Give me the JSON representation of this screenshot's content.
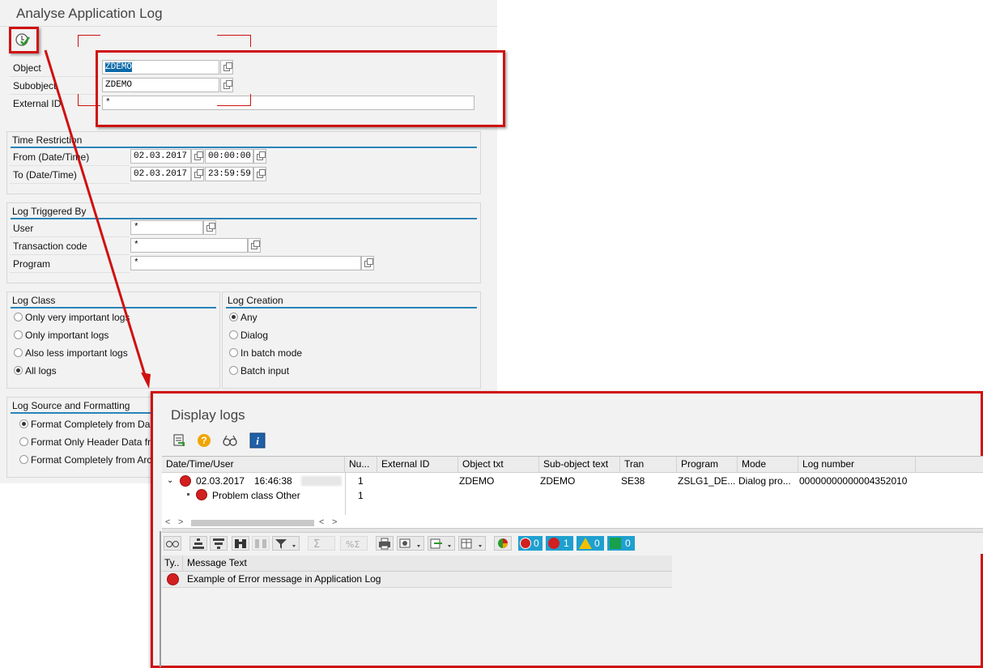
{
  "selection": {
    "title": "Analyse Application Log",
    "object_label": "Object",
    "object_value": "ZDEMO",
    "subobject_label": "Subobject",
    "subobject_value": "ZDEMO",
    "external_id_label": "External ID",
    "external_id_value": "*",
    "time_restriction": {
      "title": "Time Restriction",
      "from_label": "From (Date/Time)",
      "from_date": "02.03.2017",
      "from_time": "00:00:00",
      "to_label": "To (Date/Time)",
      "to_date": "02.03.2017",
      "to_time": "23:59:59"
    },
    "triggered_by": {
      "title": "Log Triggered By",
      "user_label": "User",
      "user_value": "*",
      "tcode_label": "Transaction code",
      "tcode_value": "*",
      "program_label": "Program",
      "program_value": "*"
    },
    "log_class": {
      "title": "Log Class",
      "options": [
        "Only very important logs",
        "Only important logs",
        "Also less important logs",
        "All logs"
      ],
      "selected": "All logs"
    },
    "log_creation": {
      "title": "Log Creation",
      "options": [
        "Any",
        "Dialog",
        "In batch mode",
        "Batch input"
      ],
      "selected": "Any"
    },
    "log_source": {
      "title": "Log Source and Formatting",
      "options": [
        "Format Completely from Da",
        "Format Only Header Data fr",
        "Format Completely from Arc"
      ],
      "selected": "Format Completely from Da"
    }
  },
  "display": {
    "title": "Display logs",
    "columns": [
      "Date/Time/User",
      "Nu...",
      "External ID",
      "Object txt",
      "Sub-object text",
      "Tran",
      "Program",
      "Mode",
      "Log number"
    ],
    "log_row": {
      "date": "02.03.2017",
      "time": "16:46:38",
      "number": "1",
      "external_id": "",
      "object_txt": "ZDEMO",
      "subobject_txt": "ZDEMO",
      "tran": "SE38",
      "program": "ZSLG1_DE...",
      "mode": "Dialog pro...",
      "log_number": "00000000000004352010"
    },
    "child_row": {
      "label": "Problem class Other",
      "number": "1"
    },
    "counters": {
      "stop": "0",
      "error": "1",
      "warning": "0",
      "info": "0"
    },
    "msg_columns": [
      "Ty..",
      "Message Text"
    ],
    "messages": [
      {
        "type": "error",
        "text": "Example of Error message in Application Log"
      }
    ]
  },
  "colors": {
    "annotation_red": "#d01010",
    "group_underline": "#2a84b8",
    "counter_bg": "#1ea0d0",
    "error_red": "#d21f1f"
  }
}
